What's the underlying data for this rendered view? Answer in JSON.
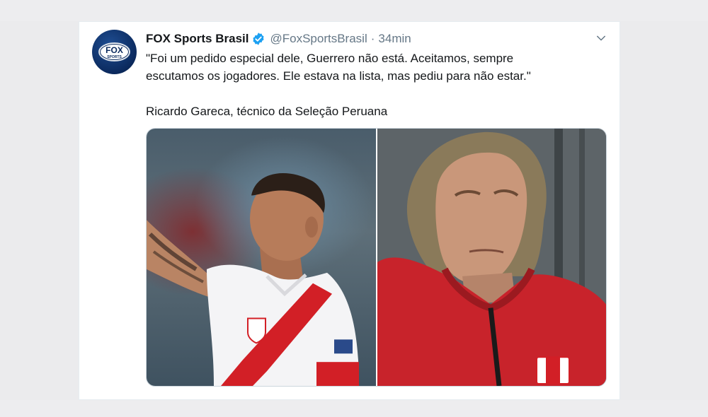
{
  "tweet": {
    "display_name": "FOX Sports Brasil",
    "handle": "@FoxSportsBrasil",
    "separator": "·",
    "time": "34min",
    "text_line_1": "\"Foi um pedido especial dele, Guerrero não está. Aceitamos, sempre",
    "text_line_2": "escutamos os jogadores. Ele estava na lista, mas pediu para não estar.\"",
    "text_line_3": "Ricardo Gareca, técnico da Seleção Peruana",
    "avatar_logo_text_top": "FOX",
    "avatar_logo_text_bottom": "SPORTS"
  },
  "icons": {
    "verified": "verified-badge-icon",
    "menu": "chevron-down-icon"
  },
  "colors": {
    "verified_blue": "#1da1f2",
    "text_primary": "#14171a",
    "text_secondary": "#657786",
    "peru_red": "#d21f26"
  },
  "media": {
    "photos": [
      {
        "description_name": "football-player-photo"
      },
      {
        "description_name": "coach-photo"
      }
    ]
  }
}
